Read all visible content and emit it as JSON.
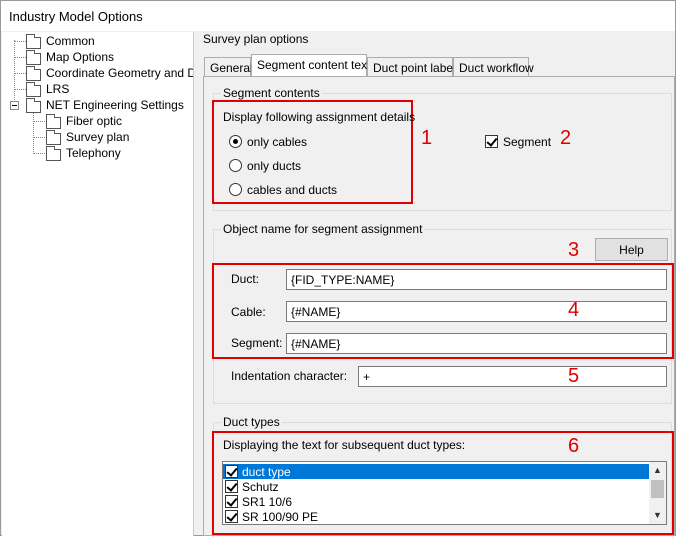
{
  "window": {
    "title": "Industry Model Options"
  },
  "tree": {
    "items": [
      {
        "label": "Common"
      },
      {
        "label": "Map Options"
      },
      {
        "label": "Coordinate Geometry and Dime"
      },
      {
        "label": "LRS"
      },
      {
        "label": "NET Engineering Settings"
      },
      {
        "label": "Fiber optic"
      },
      {
        "label": "Survey plan"
      },
      {
        "label": "Telephony"
      }
    ]
  },
  "panel": {
    "title": "Survey plan options",
    "tabs": [
      {
        "label": "General"
      },
      {
        "label": "Segment content text"
      },
      {
        "label": "Duct point label"
      },
      {
        "label": "Duct workflow"
      }
    ],
    "segment_contents": {
      "group_label": "Segment contents",
      "assignment_label": "Display following assignment details",
      "options": [
        {
          "label": "only cables",
          "selected": true
        },
        {
          "label": "only ducts",
          "selected": false
        },
        {
          "label": "cables and ducts",
          "selected": false
        }
      ],
      "segment_checkbox": {
        "label": "Segment",
        "checked": true
      }
    },
    "object_name": {
      "group_label": "Object name for segment assignment",
      "help_label": "Help",
      "fields": [
        {
          "label": "Duct:",
          "value": "{FID_TYPE:NAME}"
        },
        {
          "label": "Cable:",
          "value": "{#NAME}"
        },
        {
          "label": "Segment:",
          "value": "{#NAME}"
        }
      ],
      "indentation_label": "Indentation character:",
      "indentation_value": "+"
    },
    "duct_types": {
      "group_label": "Duct types",
      "list_label": "Displaying the text for subsequent duct types:",
      "items": [
        {
          "label": "duct type",
          "checked": true,
          "selected": true
        },
        {
          "label": "Schutz",
          "checked": true,
          "selected": false
        },
        {
          "label": "SR1 10/6",
          "checked": true,
          "selected": false
        },
        {
          "label": "SR 100/90 PE",
          "checked": true,
          "selected": false
        }
      ]
    }
  },
  "callouts": [
    "1",
    "2",
    "3",
    "4",
    "5",
    "6"
  ],
  "colors": {
    "callout": "#e00000",
    "selection": "#0078d7"
  }
}
